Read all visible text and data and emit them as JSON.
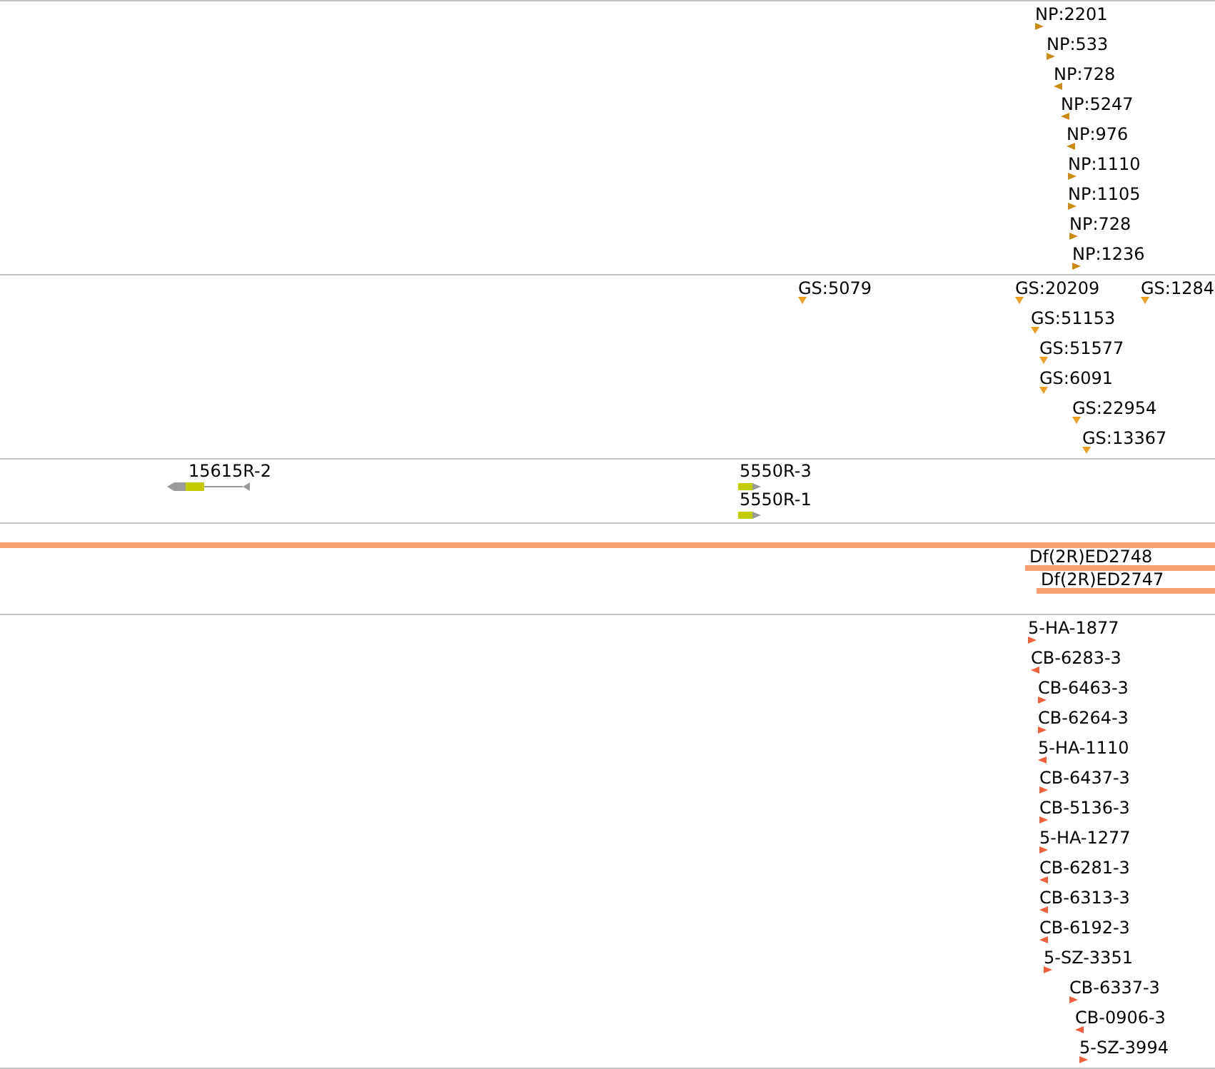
{
  "tracks": [
    {
      "kind": "stranded",
      "color": "#cc8a10",
      "features": [
        {
          "label": "NP:2201",
          "reverse": false
        },
        {
          "label": "NP:533",
          "reverse": false
        },
        {
          "label": "NP:728",
          "reverse": true
        },
        {
          "label": "NP:5247",
          "reverse": true
        },
        {
          "label": "NP:976",
          "reverse": true
        },
        {
          "label": "NP:1110",
          "reverse": false
        },
        {
          "label": "NP:1105",
          "reverse": false
        },
        {
          "label": "NP:728",
          "reverse": false
        },
        {
          "label": "NP:1236",
          "reverse": false
        }
      ]
    },
    {
      "kind": "point",
      "color": "#f0a020",
      "features": [
        {
          "label": "GS:5079"
        },
        {
          "label": "GS:20209"
        },
        {
          "label": "GS:1284"
        },
        {
          "label": "GS:51153"
        },
        {
          "label": "GS:51577"
        },
        {
          "label": "GS:6091"
        },
        {
          "label": "GS:22954"
        },
        {
          "label": "GS:13367"
        }
      ]
    },
    {
      "kind": "gene",
      "color": "#c2cc00",
      "features": [
        {
          "label": "15615R-2",
          "reverse": true
        },
        {
          "label": "5550R-3",
          "reverse": false
        },
        {
          "label": "5550R-1",
          "reverse": false
        }
      ]
    },
    {
      "kind": "bar",
      "color": "#f5a06c",
      "features": [
        {
          "full_width": true
        },
        {
          "label": "Df(2R)ED2748",
          "full_width": false
        },
        {
          "label": "Df(2R)ED2747",
          "full_width": false
        }
      ]
    },
    {
      "kind": "stranded",
      "color": "#f2603c",
      "features": [
        {
          "label": "5-HA-1877",
          "reverse": false
        },
        {
          "label": "CB-6283-3",
          "reverse": true
        },
        {
          "label": "CB-6463-3",
          "reverse": false
        },
        {
          "label": "CB-6264-3",
          "reverse": false
        },
        {
          "label": "5-HA-1110",
          "reverse": true
        },
        {
          "label": "CB-6437-3",
          "reverse": false
        },
        {
          "label": "CB-5136-3",
          "reverse": false
        },
        {
          "label": "5-HA-1277",
          "reverse": false
        },
        {
          "label": "CB-6281-3",
          "reverse": true
        },
        {
          "label": "CB-6313-3",
          "reverse": true
        },
        {
          "label": "CB-6192-3",
          "reverse": true
        },
        {
          "label": "5-SZ-3351",
          "reverse": false
        },
        {
          "label": "CB-6337-3",
          "reverse": false
        },
        {
          "label": "CB-0906-3",
          "reverse": true
        },
        {
          "label": "5-SZ-3994",
          "reverse": false
        }
      ]
    }
  ]
}
